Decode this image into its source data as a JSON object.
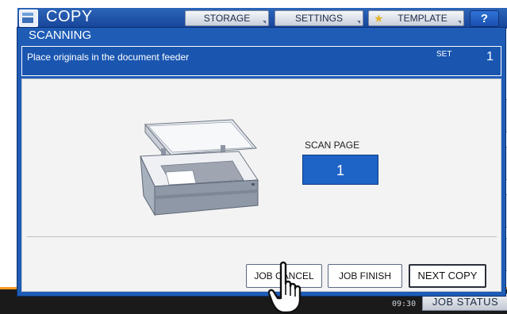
{
  "app": {
    "title": "COPY",
    "icon": "copy-app-icon"
  },
  "topbar": {
    "storage_label": "STORAGE",
    "settings_label": "SETTINGS",
    "template_label": "TEMPLATE",
    "help_label": "?"
  },
  "status": {
    "clock": "09:30",
    "job_status_label": "JOB STATUS"
  },
  "dialog": {
    "title": "SCANNING",
    "message": "Place originals in the document feeder",
    "set_label": "SET",
    "set_value": "1",
    "scan_page_label": "SCAN PAGE",
    "scan_page_value": "1",
    "buttons": {
      "job_cancel": "JOB CANCEL",
      "job_finish": "JOB FINISH",
      "next_copy": "NEXT COPY"
    }
  },
  "colors": {
    "dialog_blue": "#1f5cb6",
    "accent_orange": "#f39a1e"
  },
  "icons": [
    "copy-app-icon",
    "star-icon",
    "help-icon",
    "scanner-icon",
    "hand-pointer-icon"
  ]
}
